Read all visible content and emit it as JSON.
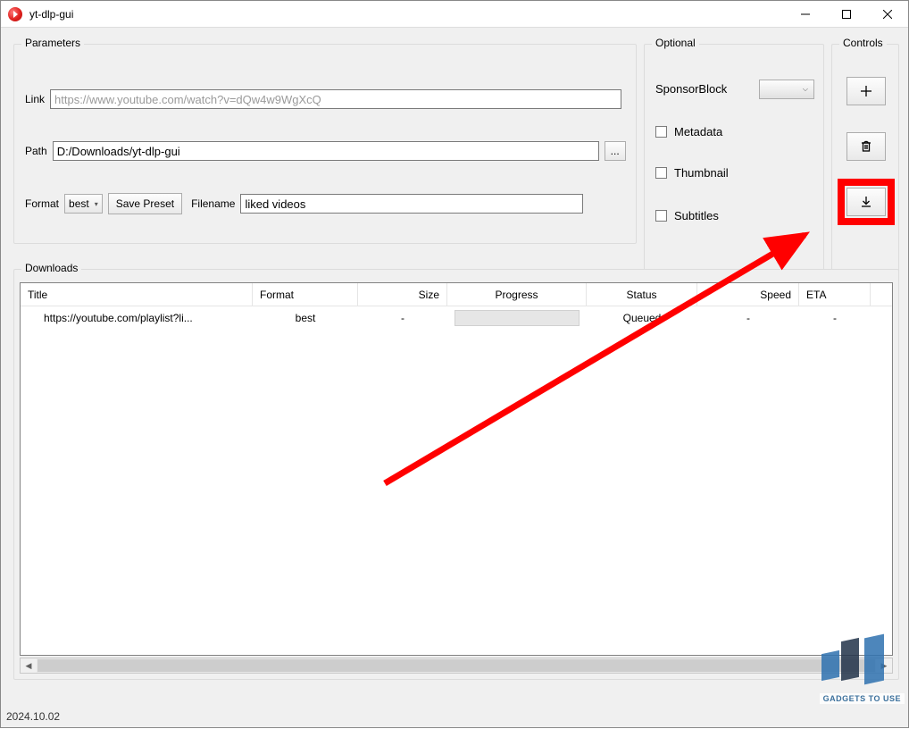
{
  "titlebar": {
    "title": "yt-dlp-gui"
  },
  "parameters": {
    "legend": "Parameters",
    "link_label": "Link",
    "link_placeholder": "https://www.youtube.com/watch?v=dQw4w9WgXcQ",
    "link_value": "",
    "path_label": "Path",
    "path_value": "D:/Downloads/yt-dlp-gui",
    "browse_label": "...",
    "format_label": "Format",
    "format_selected": "best",
    "save_preset_label": "Save Preset",
    "filename_label": "Filename",
    "filename_value": "liked videos"
  },
  "optional": {
    "legend": "Optional",
    "sponsorblock_label": "SponsorBlock",
    "sponsorblock_value": "",
    "metadata_label": "Metadata",
    "thumbnail_label": "Thumbnail",
    "subtitles_label": "Subtitles"
  },
  "controls": {
    "legend": "Controls"
  },
  "downloads": {
    "legend": "Downloads",
    "columns": [
      "Title",
      "Format",
      "Size",
      "Progress",
      "Status",
      "Speed",
      "ETA"
    ],
    "rows": [
      {
        "title": "https://youtube.com/playlist?li...",
        "format": "best",
        "size": "-",
        "progress": "",
        "status": "Queued",
        "speed": "-",
        "eta": "-"
      }
    ]
  },
  "statusbar": {
    "version": "2024.10.02"
  },
  "watermark": {
    "text": "GADGETS TO USE"
  },
  "colors": {
    "annotation": "#ff0000"
  }
}
